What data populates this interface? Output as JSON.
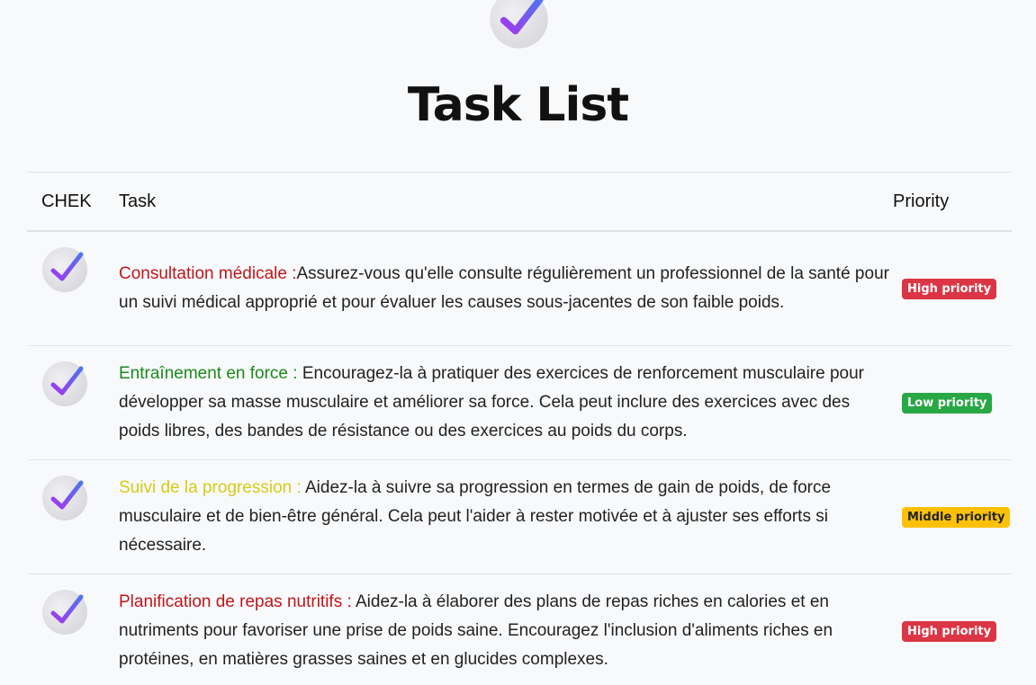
{
  "header": {
    "title": "Task List"
  },
  "table": {
    "columns": [
      "CHEK",
      "Task",
      "Priority"
    ],
    "rows": [
      {
        "title": "Consultation médicale :",
        "title_color": "#c0161b",
        "text": "Assurez-vous qu'elle consulte régulièrement un professionnel de la santé pour un suivi médical approprié et pour évaluer les causes sous-jacentes de son faible poids.",
        "priority": "High priority",
        "priority_bg": "#dc3545",
        "priority_fg": "#ffffff"
      },
      {
        "title": "Entraînement en force :",
        "title_color": "#1a8a1a",
        "text": " Encouragez-la à pratiquer des exercices de renforcement musculaire pour développer sa masse musculaire et améliorer sa force. Cela peut inclure des exercices avec des poids libres, des bandes de résistance ou des exercices au poids du corps.",
        "priority": "Low priority",
        "priority_bg": "#28a745",
        "priority_fg": "#ffffff"
      },
      {
        "title": "Suivi de la progression :",
        "title_color": "#d4cc16",
        "text": " Aidez-la à suivre sa progression en termes de gain de poids, de force musculaire et de bien-être général. Cela peut l'aider à rester motivée et à ajuster ses efforts si nécessaire.",
        "priority": "Middle priority",
        "priority_bg": "#ffc107",
        "priority_fg": "#212529"
      },
      {
        "title": "Planification de repas nutritifs :",
        "title_color": "#c0161b",
        "text": " Aidez-la à élaborer des plans de repas riches en calories et en nutriments pour favoriser une prise de poids saine. Encouragez l'inclusion d'aliments riches en protéines, en matières grasses saines et en glucides complexes.",
        "priority": "High priority",
        "priority_bg": "#dc3545",
        "priority_fg": "#ffffff"
      }
    ]
  },
  "icons": {
    "logo": "checkmark-icon",
    "row_check": "checkmark-icon"
  },
  "colors": {
    "check_gradient_start": "#5b6cf0",
    "check_gradient_end": "#9b3df0",
    "check_circle": "#e4e4e8"
  }
}
